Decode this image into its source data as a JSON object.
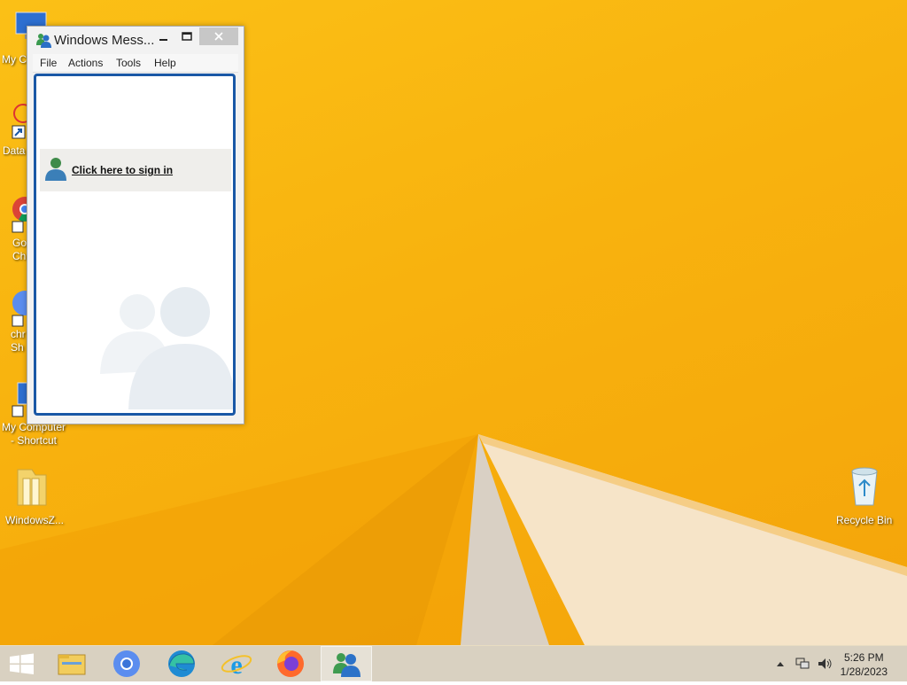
{
  "desktop": {
    "icons": [
      {
        "label": "My C",
        "icon": "computer-icon"
      },
      {
        "label": "Data",
        "icon": "datavis-icon"
      },
      {
        "label": "Go\nCh",
        "icon": "chrome-icon"
      },
      {
        "label": "chr\nSh",
        "icon": "chrome-shortcut-icon"
      },
      {
        "label": "My Computer\n- Shortcut",
        "icon": "computer-shortcut-icon"
      },
      {
        "label": "WindowsZ...",
        "icon": "folder-icon"
      },
      {
        "label": "Recycle Bin",
        "icon": "recycle-bin-icon"
      }
    ]
  },
  "messenger": {
    "title": "Windows Mess...",
    "menu": [
      "File",
      "Actions",
      "Tools",
      "Help"
    ],
    "signin_link": "Click here to sign in"
  },
  "taskbar": {
    "apps": [
      "start-button",
      "file-explorer-icon",
      "chrome-icon",
      "edge-icon",
      "internet-explorer-icon",
      "firefox-icon",
      "messenger-icon"
    ],
    "time": "5:26 PM",
    "date": "1/28/2023"
  },
  "colors": {
    "wallpaper": "#f8b20e",
    "window_border": "#1a58a6",
    "taskbar": "#d6cdbc"
  }
}
